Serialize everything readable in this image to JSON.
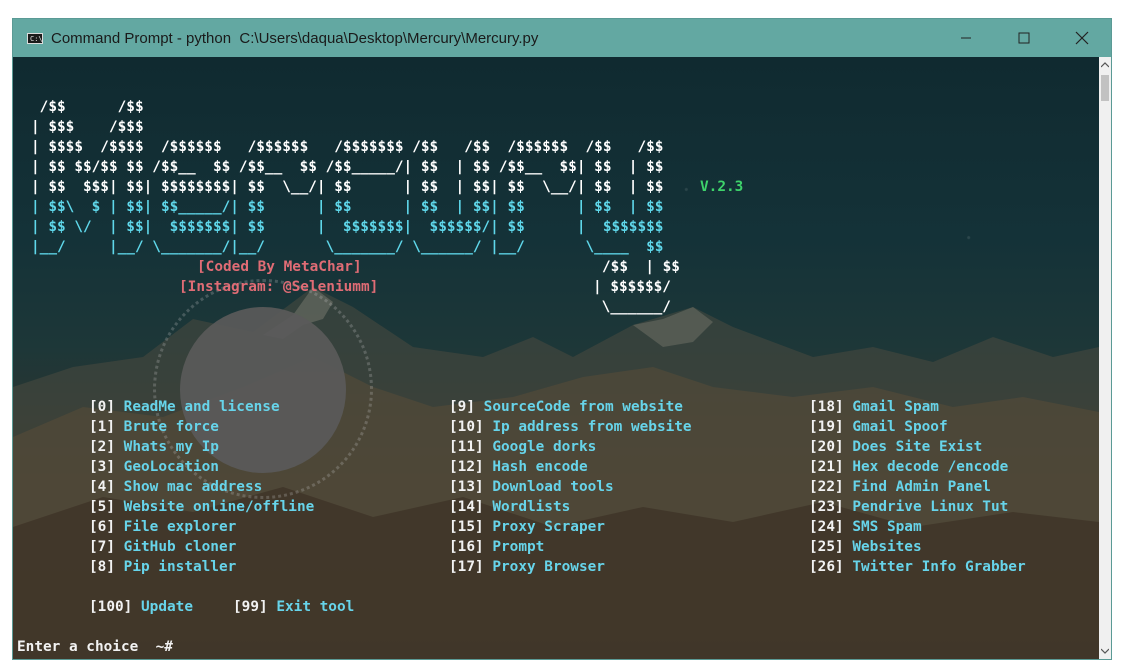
{
  "window": {
    "title": "Command Prompt - python  C:\\Users\\daqua\\Desktop\\Mercury\\Mercury.py",
    "icon_label": "C:\\"
  },
  "banner": {
    "ascii_white": [
      " /$$      /$$",
      "| $$$    /$$$",
      "| $$$$  /$$$$  /$$$$$$   /$$$$$$   /$$$$$$$ /$$   /$$  /$$$$$$  /$$   /$$",
      "| $$ $$/$$ $$ /$$__  $$ /$$__  $$ /$$_____/| $$  | $$ /$$__  $$| $$  | $$",
      "| $$  $$$| $$| $$$$$$$$| $$  \\__/| $$      | $$  | $$| $$  \\__/| $$  | $$"
    ],
    "ascii_cyan": [
      "| $$\\  $ | $$| $$_____/| $$      | $$      | $$  | $$| $$      | $$  | $$",
      "| $$ \\/  | $$|  $$$$$$$| $$      |  $$$$$$$|  $$$$$$/| $$      |  $$$$$$$",
      "|__/     |__/ \\_______/|__/       \\_______/ \\______/ |__/       \\____  $$"
    ],
    "ascii_white_tail": [
      "/$$  | $$",
      "| $$$$$$/",
      " \\______/"
    ],
    "version": "V.2.3",
    "coded_by": "[Coded By MetaChar]",
    "instagram": "[Instagram: @Seleniumm]"
  },
  "menu": {
    "col1": [
      {
        "key": "[0]",
        "label": "ReadMe and license"
      },
      {
        "key": "[1]",
        "label": "Brute force"
      },
      {
        "key": "[2]",
        "label": "Whats my Ip"
      },
      {
        "key": "[3]",
        "label": "GeoLocation"
      },
      {
        "key": "[4]",
        "label": "Show mac address"
      },
      {
        "key": "[5]",
        "label": "Website online/offline"
      },
      {
        "key": "[6]",
        "label": "File explorer"
      },
      {
        "key": "[7]",
        "label": "GitHub cloner"
      },
      {
        "key": "[8]",
        "label": "Pip installer"
      }
    ],
    "col2": [
      {
        "key": "[9]",
        "label": "SourceCode from website"
      },
      {
        "key": "[10]",
        "label": "Ip address from website"
      },
      {
        "key": "[11]",
        "label": "Google dorks"
      },
      {
        "key": "[12]",
        "label": "Hash encode"
      },
      {
        "key": "[13]",
        "label": "Download tools"
      },
      {
        "key": "[14]",
        "label": "Wordlists"
      },
      {
        "key": "[15]",
        "label": "Proxy Scraper"
      },
      {
        "key": "[16]",
        "label": "Prompt"
      },
      {
        "key": "[17]",
        "label": "Proxy Browser"
      }
    ],
    "col3": [
      {
        "key": "[18]",
        "label": "Gmail Spam"
      },
      {
        "key": "[19]",
        "label": "Gmail Spoof"
      },
      {
        "key": "[20]",
        "label": "Does Site Exist"
      },
      {
        "key": "[21]",
        "label": "Hex decode /encode"
      },
      {
        "key": "[22]",
        "label": "Find Admin Panel"
      },
      {
        "key": "[23]",
        "label": "Pendrive Linux Tut"
      },
      {
        "key": "[24]",
        "label": "SMS Spam"
      },
      {
        "key": "[25]",
        "label": "Websites"
      },
      {
        "key": "[26]",
        "label": "Twitter Info Grabber"
      }
    ],
    "extra": [
      {
        "key": "[100]",
        "label": "Update"
      },
      {
        "key": "[99]",
        "label": "Exit tool"
      }
    ]
  },
  "prompt": "Enter a choice  ~#",
  "colors": {
    "titlebar": "#63a8a2",
    "option_text": "#67d4ea",
    "version_text": "#3ed36b",
    "credit_text": "#e06c75"
  },
  "icons": {
    "minimize": "minimize-icon",
    "maximize": "maximize-icon",
    "close": "close-icon"
  }
}
